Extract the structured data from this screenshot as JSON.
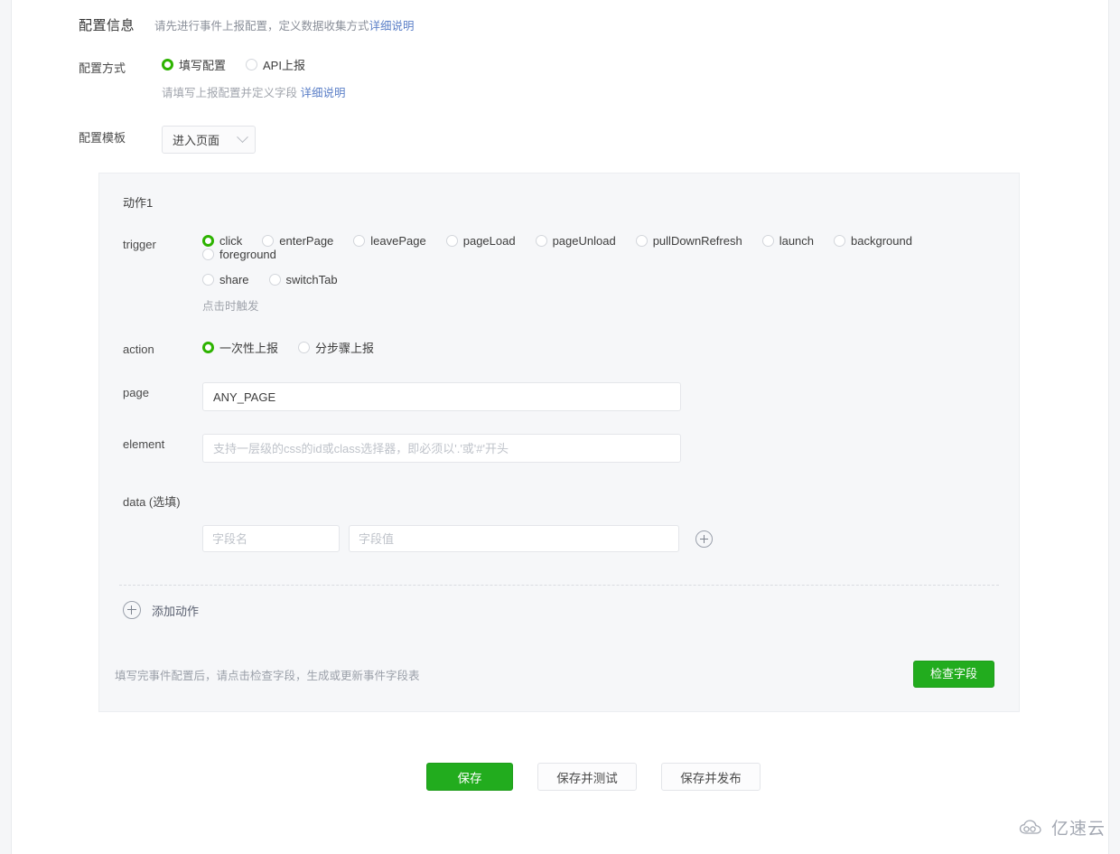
{
  "header": {
    "title": "配置信息",
    "subtitle": "请先进行事件上报配置，定义数据收集方式",
    "detail_link": "详细说明"
  },
  "config_method": {
    "label": "配置方式",
    "options": [
      {
        "label": "填写配置",
        "checked": true
      },
      {
        "label": "API上报",
        "checked": false
      }
    ],
    "hint": "请填写上报配置并定义字段",
    "detail_link": "详细说明"
  },
  "config_template": {
    "label": "配置模板",
    "selected": "进入页面",
    "icon": "chevron-down-icon"
  },
  "action_panel": {
    "title": "动作1",
    "trigger": {
      "label": "trigger",
      "options": [
        {
          "label": "click",
          "checked": true
        },
        {
          "label": "enterPage",
          "checked": false
        },
        {
          "label": "leavePage",
          "checked": false
        },
        {
          "label": "pageLoad",
          "checked": false
        },
        {
          "label": "pageUnload",
          "checked": false
        },
        {
          "label": "pullDownRefresh",
          "checked": false
        },
        {
          "label": "launch",
          "checked": false
        },
        {
          "label": "background",
          "checked": false
        },
        {
          "label": "foreground",
          "checked": false
        },
        {
          "label": "share",
          "checked": false
        },
        {
          "label": "switchTab",
          "checked": false
        }
      ],
      "hint": "点击时触发"
    },
    "action": {
      "label": "action",
      "options": [
        {
          "label": "一次性上报",
          "checked": true
        },
        {
          "label": "分步骤上报",
          "checked": false
        }
      ]
    },
    "page": {
      "label": "page",
      "value": "ANY_PAGE",
      "placeholder": ""
    },
    "element": {
      "label": "element",
      "value": "",
      "placeholder": "支持一层级的css的id或class选择器，即必须以'.'或'#'开头"
    },
    "data": {
      "label": "data (选填)",
      "key_placeholder": "字段名",
      "key_value": "",
      "value_placeholder": "字段值",
      "value_value": "",
      "add_icon": "plus-circle-icon"
    },
    "add_action": {
      "label": "添加动作",
      "icon": "plus-circle-icon"
    },
    "footer": {
      "note": "填写完事件配置后，请点击检查字段，生成或更新事件字段表",
      "check_button": "检查字段"
    }
  },
  "bottom_buttons": [
    {
      "label": "保存",
      "style": "primary"
    },
    {
      "label": "保存并测试",
      "style": "default"
    },
    {
      "label": "保存并发布",
      "style": "default"
    }
  ],
  "watermark": {
    "text": "亿速云",
    "icon": "cloud-icon"
  },
  "colors": {
    "accent_green": "#22ac1e",
    "link_blue": "#5b7fc7",
    "panel_bg": "#f6f7f9",
    "page_bg": "#ffffff"
  }
}
